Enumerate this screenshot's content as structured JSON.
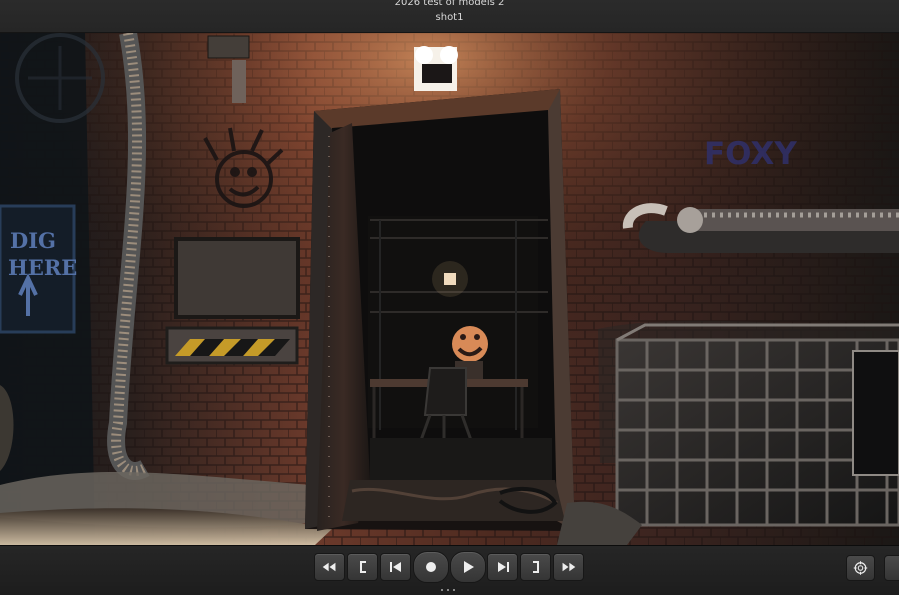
{
  "window": {
    "project_title": "2026 test of models 2",
    "shot_name": "shot1"
  },
  "viewport": {
    "scene": "dark brick alley with open doorway and chair-seated smiling figure",
    "wall_graffiti": {
      "sign_line1": "DIG",
      "sign_line2": "HERE",
      "tag": "FOXY"
    }
  },
  "transport": {
    "buttons": [
      {
        "name": "rewind-button",
        "icon": "rewind-icon"
      },
      {
        "name": "mark-in-button",
        "icon": "bracket-left-icon"
      },
      {
        "name": "prev-frame-button",
        "icon": "step-back-icon"
      },
      {
        "name": "record-button",
        "icon": "record-icon"
      },
      {
        "name": "play-button",
        "icon": "play-icon"
      },
      {
        "name": "next-frame-button",
        "icon": "step-forward-icon"
      },
      {
        "name": "mark-out-button",
        "icon": "bracket-right-icon"
      },
      {
        "name": "fast-forward-button",
        "icon": "fast-forward-icon"
      }
    ]
  },
  "right_controls": {
    "target_icon": "target-icon",
    "extra_button": "panel-button"
  },
  "colors": {
    "ui_dark": "#202020",
    "button_top": "#4a4a4a",
    "button_bottom": "#353535",
    "brick_warm": "#7b3f2c",
    "shadow": "#120d0b"
  }
}
